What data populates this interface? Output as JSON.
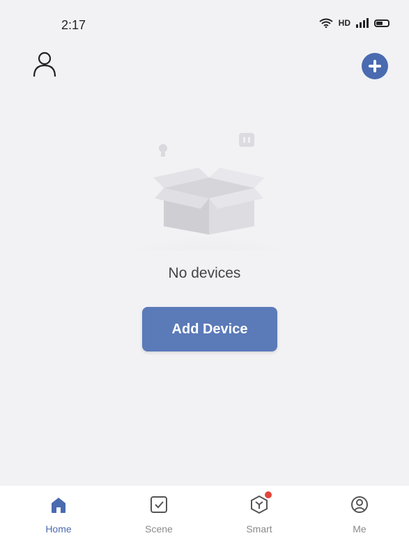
{
  "status_bar": {
    "time": "2:17",
    "indicators": "HDᵃ ⁴ᴳ"
  },
  "header": {
    "profile_icon": "person-outline-icon",
    "add_icon": "plus-circle-icon",
    "accent_color": "#4a6bb0"
  },
  "empty_state": {
    "illustration": "empty-box-icon",
    "message": "No devices",
    "add_button_label": "Add Device"
  },
  "tabs": [
    {
      "label": "Home",
      "icon": "home-icon",
      "active": true
    },
    {
      "label": "Scene",
      "icon": "scene-checkbox-icon",
      "active": false
    },
    {
      "label": "Smart",
      "icon": "smart-hub-icon",
      "active": false,
      "badge": true
    },
    {
      "label": "Me",
      "icon": "user-circle-icon",
      "active": false
    }
  ]
}
